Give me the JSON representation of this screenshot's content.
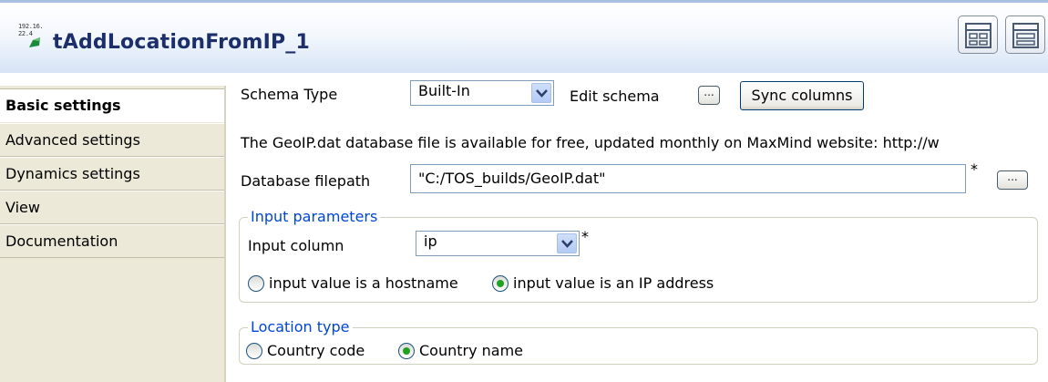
{
  "header": {
    "icon_text_line1": "192.16.",
    "icon_text_line2": "22.4",
    "title": "tAddLocationFromIP_1",
    "layout_buttons": [
      "grid-layout-icon",
      "row-layout-icon"
    ]
  },
  "sidebar": {
    "items": [
      {
        "label": "Basic settings",
        "active": true
      },
      {
        "label": "Advanced settings",
        "active": false
      },
      {
        "label": "Dynamics settings",
        "active": false
      },
      {
        "label": "View",
        "active": false
      },
      {
        "label": "Documentation",
        "active": false
      }
    ]
  },
  "schema": {
    "label": "Schema Type",
    "value": "Built-In",
    "edit_label": "Edit schema",
    "edit_button": "...",
    "sync_label": "Sync columns"
  },
  "info_text": "The GeoIP.dat database file is available for free, updated monthly on MaxMind website: http://w",
  "database": {
    "label": "Database filepath",
    "value": "\"C:/TOS_builds/GeoIP.dat\"",
    "required": "*",
    "browse": "..."
  },
  "input_params": {
    "title": "Input parameters",
    "column_label": "Input column",
    "column_value": "ip",
    "required": "*",
    "radio_hostname": "input value is a hostname",
    "radio_ip": "input value is an IP address",
    "selected": "ip"
  },
  "location_type": {
    "title": "Location type",
    "radio_code": "Country code",
    "radio_name": "Country name",
    "selected": "name"
  },
  "colors": {
    "title": "#1c2f6b",
    "group_title": "#0046d5",
    "sidebar_bg": "#ece9d8",
    "radio_selected": "#21a121"
  }
}
